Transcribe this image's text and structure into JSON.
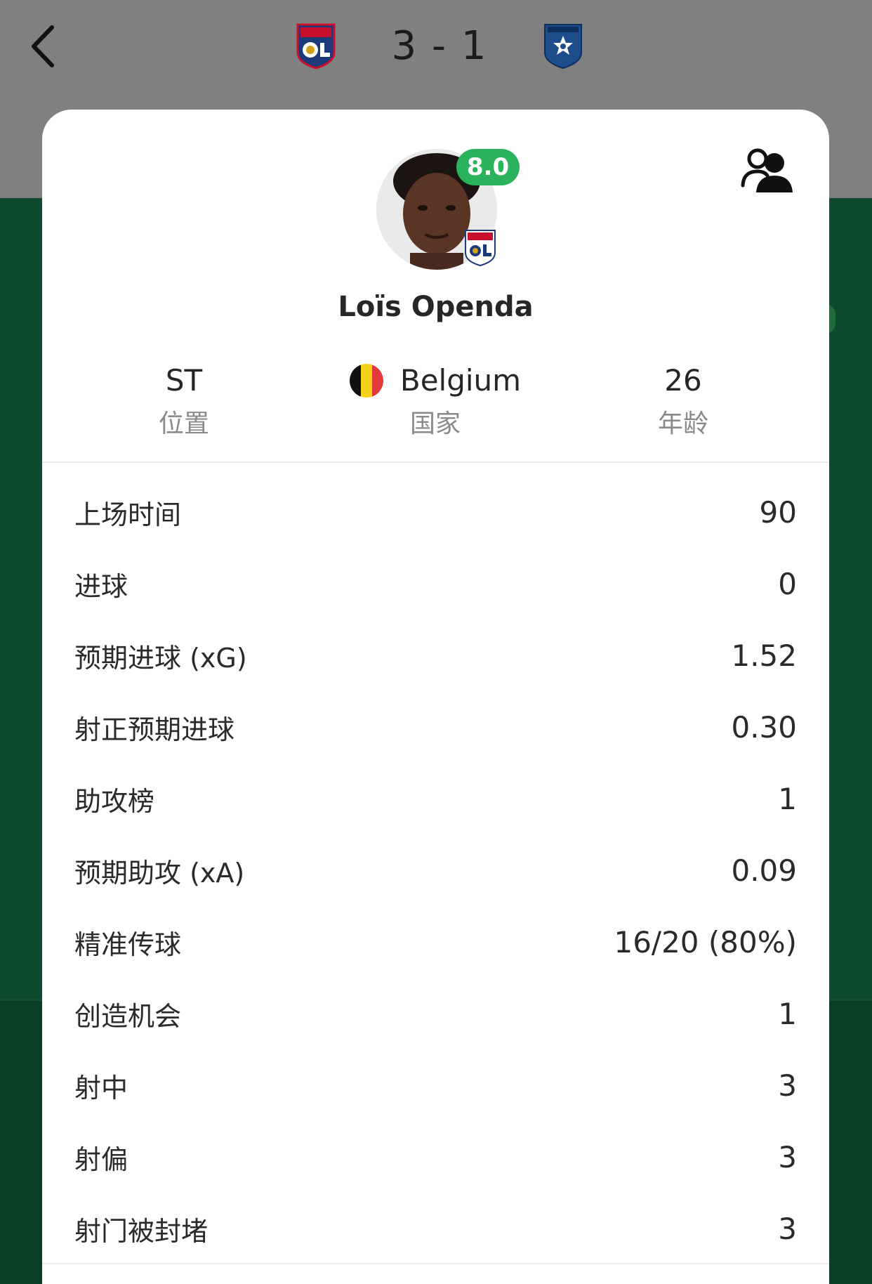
{
  "header": {
    "home_score": "3",
    "separator": "-",
    "away_score": "1",
    "home_crest": "olympique-lyonnais-crest",
    "away_crest": "aj-auxerre-crest"
  },
  "player": {
    "name": "Loïs Openda",
    "rating": "8.0",
    "rating_color": "#2bb25c",
    "position_value": "ST",
    "position_label": "位置",
    "country_value": "Belgium",
    "country_label": "国家",
    "age_value": "26",
    "age_label": "年龄"
  },
  "stats": [
    {
      "label": "上场时间",
      "value": "90"
    },
    {
      "label": "进球",
      "value": "0"
    },
    {
      "label": "预期进球 (xG)",
      "value": "1.52"
    },
    {
      "label": "射正预期进球",
      "value": "0.30"
    },
    {
      "label": "助攻榜",
      "value": "1"
    },
    {
      "label": "预期助攻 (xA)",
      "value": "0.09"
    },
    {
      "label": "精准传球",
      "value": "16/20 (80%)"
    },
    {
      "label": "创造机会",
      "value": "1"
    },
    {
      "label": "射中",
      "value": "3"
    },
    {
      "label": "射偏",
      "value": "3"
    },
    {
      "label": "射门被封堵",
      "value": "3"
    }
  ]
}
